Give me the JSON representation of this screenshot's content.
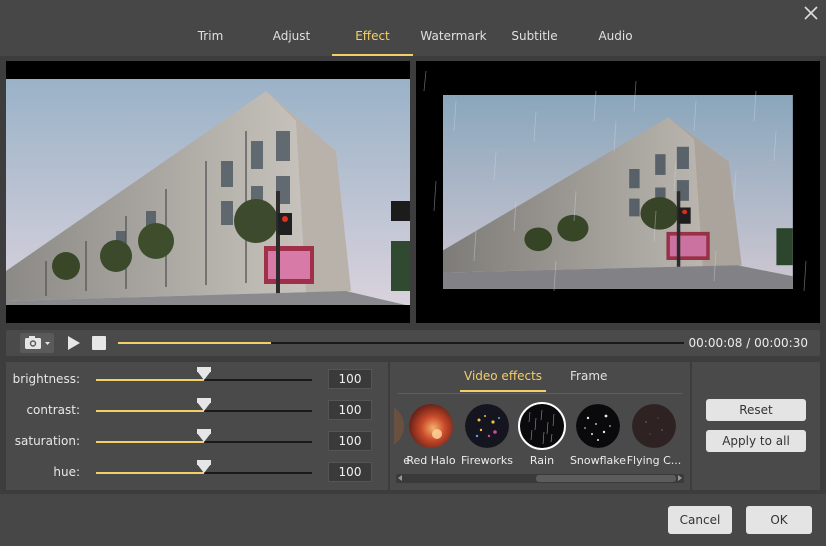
{
  "tabs": [
    {
      "label": "Trim",
      "active": false
    },
    {
      "label": "Adjust",
      "active": false
    },
    {
      "label": "Effect",
      "active": true
    },
    {
      "label": "Watermark",
      "active": false
    },
    {
      "label": "Subtitle",
      "active": false
    },
    {
      "label": "Audio",
      "active": false
    }
  ],
  "playback": {
    "current_time": "00:00:08",
    "separator": " / ",
    "total_time": "00:00:30",
    "progress_fraction": 0.27
  },
  "adjustments": [
    {
      "label": "brightness:",
      "value": "100",
      "fraction": 0.5
    },
    {
      "label": "contrast:",
      "value": "100",
      "fraction": 0.5
    },
    {
      "label": "saturation:",
      "value": "100",
      "fraction": 0.5
    },
    {
      "label": "hue:",
      "value": "100",
      "fraction": 0.5
    }
  ],
  "effect_tabs": [
    {
      "label": "Video effects",
      "active": true
    },
    {
      "label": "Frame",
      "active": false
    }
  ],
  "effects": [
    {
      "label": "e",
      "selected": false
    },
    {
      "label": "Red Halo",
      "selected": false
    },
    {
      "label": "Fireworks",
      "selected": false
    },
    {
      "label": "Rain",
      "selected": true
    },
    {
      "label": "Snowflake",
      "selected": false
    },
    {
      "label": "Flying C...",
      "selected": false
    }
  ],
  "actions": {
    "reset_label": "Reset",
    "apply_all_label": "Apply to all"
  },
  "footer": {
    "cancel_label": "Cancel",
    "ok_label": "OK"
  },
  "colors": {
    "accent": "#f3cf68",
    "panel_bg": "#4a4a4a",
    "window_bg": "#3d3d3d"
  },
  "icons": {
    "close": "close-icon",
    "camera": "camera-icon",
    "play": "play-icon",
    "stop": "stop-icon"
  }
}
